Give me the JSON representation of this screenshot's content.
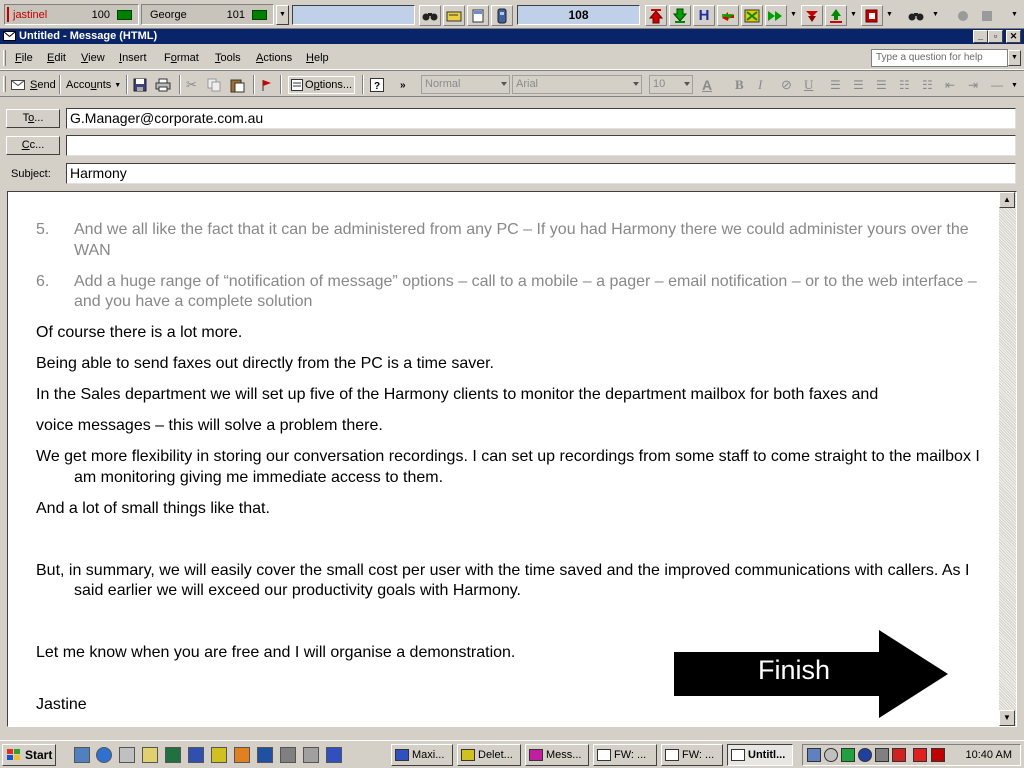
{
  "phonebar": {
    "line1": {
      "name": "jastinel",
      "value": "100"
    },
    "line2": {
      "name": "George",
      "value": "101"
    },
    "counter": "108"
  },
  "window": {
    "title": "Untitled - Message (HTML)"
  },
  "menu": {
    "items": [
      {
        "pre": "",
        "u": "F",
        "post": "ile"
      },
      {
        "pre": "",
        "u": "E",
        "post": "dit"
      },
      {
        "pre": "",
        "u": "V",
        "post": "iew"
      },
      {
        "pre": "",
        "u": "I",
        "post": "nsert"
      },
      {
        "pre": "F",
        "u": "o",
        "post": "rmat"
      },
      {
        "pre": "",
        "u": "T",
        "post": "ools"
      },
      {
        "pre": "",
        "u": "A",
        "post": "ctions"
      },
      {
        "pre": "",
        "u": "H",
        "post": "elp"
      }
    ],
    "help_placeholder": "Type a question for help"
  },
  "toolbar": {
    "send": {
      "u": "S",
      "post": "end"
    },
    "accounts": {
      "pre": "Acco",
      "u": "u",
      "post": "nts"
    },
    "options": {
      "pre": "O",
      "u": "p",
      "post": "tions..."
    },
    "style": "Normal",
    "font": "Arial",
    "size": "10"
  },
  "header": {
    "to_btn": {
      "pre": "T",
      "u": "o",
      "post": "..."
    },
    "cc_btn": {
      "pre": "",
      "u": "C",
      "post": "c..."
    },
    "subject_label": "Subject:",
    "to": "G.Manager@corporate.com.au",
    "cc": "",
    "subject": "Harmony"
  },
  "body": {
    "list": [
      {
        "n": "5.",
        "text": "And we all like the fact that it can be administered from any PC – If you had Harmony there we could administer yours over the WAN"
      },
      {
        "n": "6.",
        "text": "Add a huge range of “notification of message” options – call to a mobile – a pager – email notification – or to the web interface – and you have a complete solution"
      }
    ],
    "p1": "Of course there is a lot more.",
    "p2": "Being able to send faxes out directly from the PC is a time saver.",
    "p3": "In the Sales department we will set up five of the Harmony clients to monitor the department mailbox for both faxes and",
    "p4": "voice messages – this will solve a problem there.",
    "p5": "We get more flexibility in storing our conversation recordings. I can set up recordings from some staff to come straight to the mailbox I am monitoring giving me immediate access to them.",
    "p6": "And a lot of small things like that.",
    "p7": "But, in summary, we will easily cover the small cost per user with the time saved and the improved communications with callers. As I said earlier we will exceed our productivity goals with Harmony.",
    "p8": "Let me know when you are free and I will organise a demonstration.",
    "signature": "Jastine"
  },
  "finish_label": "Finish",
  "taskbar": {
    "start": "Start",
    "tasks": [
      "Maxi...",
      "Delet...",
      "Mess...",
      "FW: ...",
      "FW: ...",
      "Untitl..."
    ],
    "clock": "10:40 AM"
  },
  "colors": {
    "titlebar": "#0a246a",
    "face": "#d4d0c8",
    "list_gray": "#888888"
  }
}
